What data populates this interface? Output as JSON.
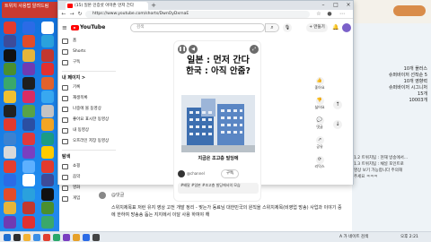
{
  "desktop": {
    "icon_colors": [
      "#e23b2e",
      "#2b6be6",
      "#ffffff",
      "#3d4c9a",
      "#e24c2a",
      "#2aa1dd",
      "#111111",
      "#e6b53a",
      "#c2372f",
      "#4a8f2f",
      "#6f3bb3",
      "#e23030",
      "#3aa86b",
      "#1f1f1f",
      "#e2622c",
      "#f0c030",
      "#d92c63",
      "#38a8f0",
      "#222222",
      "#58a346",
      "#c4c4c4",
      "#e23a2e",
      "#2b4fa3",
      "#f2a524",
      "#3b82d1",
      "#e03a3a",
      "#1b9c85",
      "#d9d9d9",
      "#7a3fc0",
      "#ffcc00",
      "#e33e2f",
      "#5db0ff"
    ],
    "notice_tile_text": "트위치 사용법 알려드림"
  },
  "browser": {
    "tab_title": "(15) 일본 인증샷 아마존 먼저 간다",
    "url": "https://www.youtube.com/shorts/DwnOyDxrnaE"
  },
  "youtube": {
    "logo": "YouTube",
    "search_placeholder": "검색",
    "create_label": "+ 만들기",
    "sidebar": {
      "items_top": [
        {
          "label": "홈",
          "icon": "home-icon"
        },
        {
          "label": "Shorts",
          "icon": "shorts-icon"
        },
        {
          "label": "구독",
          "icon": "subscriptions-icon"
        }
      ],
      "my_page_heading": "내 페이지 >",
      "items_mine": [
        {
          "label": "기록",
          "icon": "history-icon"
        },
        {
          "label": "재생목록",
          "icon": "playlist-icon"
        },
        {
          "label": "나중에 볼 동영상",
          "icon": "watch-later-icon"
        },
        {
          "label": "좋아요 표시한 동영상",
          "icon": "like-icon"
        },
        {
          "label": "내 동영상",
          "icon": "video-icon"
        },
        {
          "label": "오프라인 저장 동영상",
          "icon": "download-icon"
        }
      ],
      "explore_heading": "탐색",
      "items_explore": [
        {
          "label": "쇼핑",
          "icon": "shopping-icon"
        },
        {
          "label": "음악",
          "icon": "music-icon"
        },
        {
          "label": "영화",
          "icon": "movie-icon"
        },
        {
          "label": "게임",
          "icon": "gaming-icon"
        }
      ]
    },
    "short": {
      "headline_line1": "일본 : 먼저 간다",
      "headline_line2": "한국 : 아직 안줌?",
      "caption": "지금은 조고층 빌딩에",
      "channel_name": "@channel",
      "subscribe_label": "구독",
      "title": "#배달 #일본 #조고층 빌딩에서의 모습"
    },
    "rail": [
      "좋아요",
      "싫어요",
      "댓글",
      "공유",
      "리믹스"
    ]
  },
  "chat_overlay": {
    "notice_lines": [
      "10개 플러스",
      "슈퍼바이저 선착순 5",
      "10개 영향력",
      "슈퍼바이저 시그니처",
      "15개",
      "10003개"
    ],
    "chat_lines": [
      "1.2 트위치팀 : 현재 방송에서...",
      "1.3 트위치팀 : 채널 포인트로",
      "영상 보기 가능합니다 주의해",
      "주세요 ㅋㅋㅋ"
    ]
  },
  "comment": {
    "user": "@댓글",
    "text": "스위치제목표 저런 유지 영상 고전 개발 정리 - 맞는가 동료님 대한민국의 원칙을 스위치제목(비영업 방송) 사업과 이야기 중에 한하여 방송송 돕는 지지에서 이달 사용 하여야 해"
  },
  "taskbar": {
    "tray_text": "A 가 네이트 검색",
    "clock": "오후 2:21"
  }
}
